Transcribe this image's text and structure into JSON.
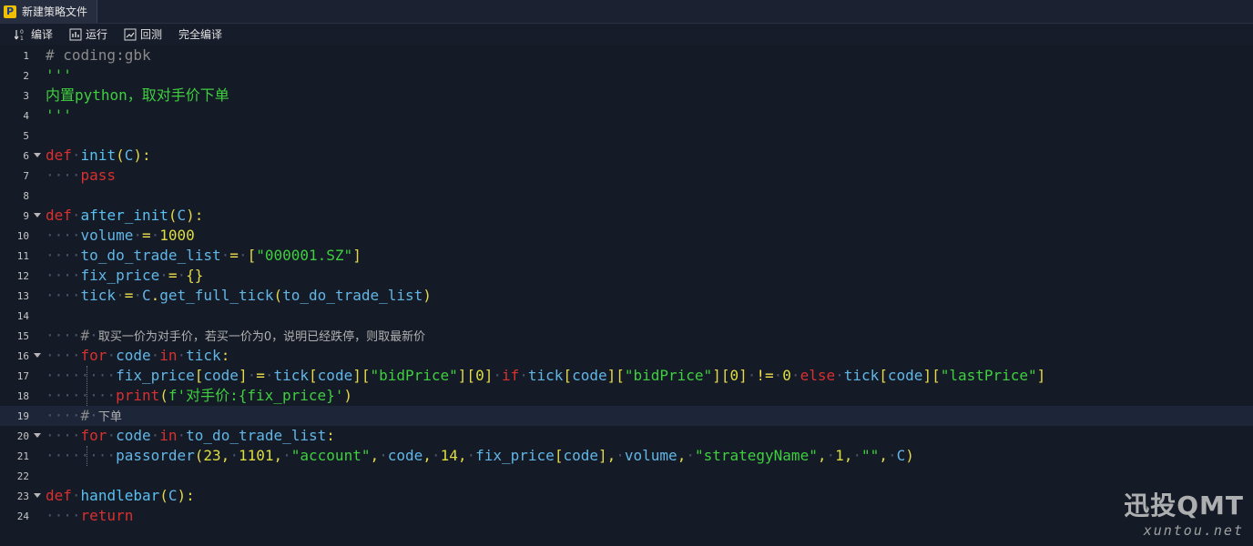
{
  "tab": {
    "icon": "P",
    "label": "新建策略文件"
  },
  "toolbar": {
    "compile": "编译",
    "run": "运行",
    "backtest": "回测",
    "full_compile": "完全编译"
  },
  "editor": {
    "line_numbers": [
      "1",
      "2",
      "3",
      "4",
      "5",
      "6",
      "7",
      "8",
      "9",
      "10",
      "11",
      "12",
      "13",
      "14",
      "15",
      "16",
      "17",
      "18",
      "19",
      "20",
      "21",
      "22",
      "23",
      "24"
    ],
    "l1": "# coding:gbk",
    "l2": "'''",
    "l3": "内置python，取对手价下单",
    "l4": "'''",
    "l6_kw": "def",
    "l6_fn": "init",
    "l6_arg": "C",
    "l7": "pass",
    "l9_kw": "def",
    "l9_fn": "after_init",
    "l9_arg": "C",
    "l10_var": "volume",
    "l10_val": "1000",
    "l11_var": "to_do_trade_list",
    "l11_val": "\"000001.SZ\"",
    "l12_var": "fix_price",
    "l13_var": "tick",
    "l13_obj": "C",
    "l13_fn": "get_full_tick",
    "l13_arg": "to_do_trade_list",
    "l15_hash": "#",
    "l15_text": "取买一价为对手价，若买一价为0，说明已经跌停，则取最新价",
    "l16_kw": "for",
    "l16_var": "code",
    "l16_in": "in",
    "l16_obj": "tick",
    "l17_var": "fix_price",
    "l17_idx": "code",
    "l17_tick": "tick",
    "l17_bid": "\"bidPrice\"",
    "l17_zero": "0",
    "l17_if": "if",
    "l17_ne": "!=",
    "l17_else": "else",
    "l17_last": "\"lastPrice\"",
    "l18_fn": "print",
    "l18_str": "f'对手价:{fix_price}'",
    "l19_hash": "#",
    "l19_text": "下单",
    "l20_kw": "for",
    "l20_var": "code",
    "l20_in": "in",
    "l20_obj": "to_do_trade_list",
    "l21_fn": "passorder",
    "l21_a1": "23",
    "l21_a2": "1101",
    "l21_a3": "\"account\"",
    "l21_a4": "code",
    "l21_a5": "14",
    "l21_a6": "fix_price",
    "l21_a7": "volume",
    "l21_a8": "\"strategyName\"",
    "l21_a9": "1",
    "l21_a10": "\"\"",
    "l21_a11": "C",
    "l23_kw": "def",
    "l23_fn": "handlebar",
    "l23_arg": "C",
    "l24": "return"
  },
  "watermark": {
    "title": "迅投QMT",
    "url": "xuntou.net"
  },
  "colors": {
    "keyword": "#d93030",
    "string": "#3fcf3f",
    "identifier": "#62b6e6",
    "paren": "#e4d94c",
    "comment": "#8a8a8a",
    "background": "#141a26"
  }
}
